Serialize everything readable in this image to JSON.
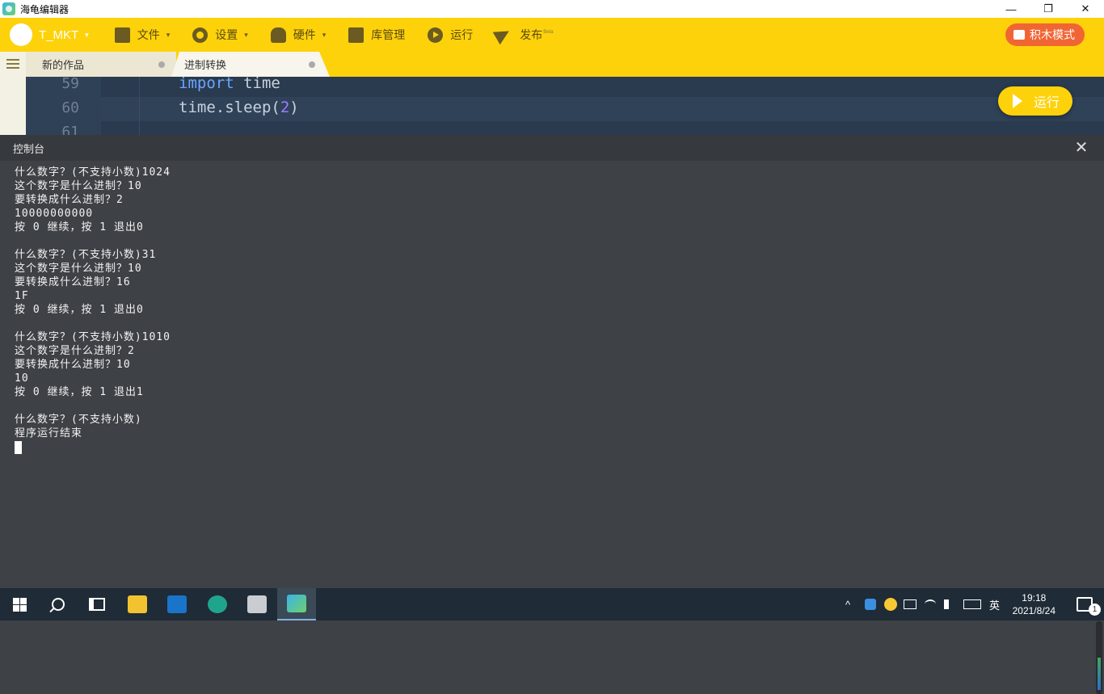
{
  "window": {
    "title": "海龟编辑器",
    "minimize": "—",
    "restore": "❐",
    "close": "✕"
  },
  "menubar": {
    "user": "T_MKT",
    "file": "文件",
    "settings": "设置",
    "hardware": "硬件",
    "library": "库管理",
    "run": "运行",
    "publish": "发布",
    "publish_badge": "Beta",
    "block_mode": "积木模式",
    "caret": "▾"
  },
  "tabs": [
    {
      "label": "新的作品"
    },
    {
      "label": "进制转换"
    }
  ],
  "editor": {
    "lines": [
      {
        "no": "59",
        "kw": "import",
        "rest": " time"
      },
      {
        "no": "60",
        "code_a": "time.sleep(",
        "num": "2",
        "code_b": ")"
      },
      {
        "no": "61"
      }
    ],
    "run_button": "运行"
  },
  "console": {
    "title": "控制台",
    "close": "✕",
    "output": [
      "什么数字？(不支持小数)1024",
      "这个数字是什么进制？10",
      "要转换成什么进制？2",
      "10000000000",
      "按 0 继续，按 1 退出0",
      "",
      "什么数字？(不支持小数)31",
      "这个数字是什么进制？10",
      "要转换成什么进制？16",
      "1F",
      "按 0 继续，按 1 退出0",
      "",
      "什么数字？(不支持小数)1010",
      "这个数字是什么进制？2",
      "要转换成什么进制？10",
      "10",
      "按 0 继续，按 1 退出1",
      "",
      "什么数字？(不支持小数)",
      "程序运行结束"
    ]
  },
  "taskbar": {
    "time": "19:18",
    "date": "2021/8/24",
    "ime": "英",
    "notification_count": "1",
    "tray_up": "^"
  }
}
